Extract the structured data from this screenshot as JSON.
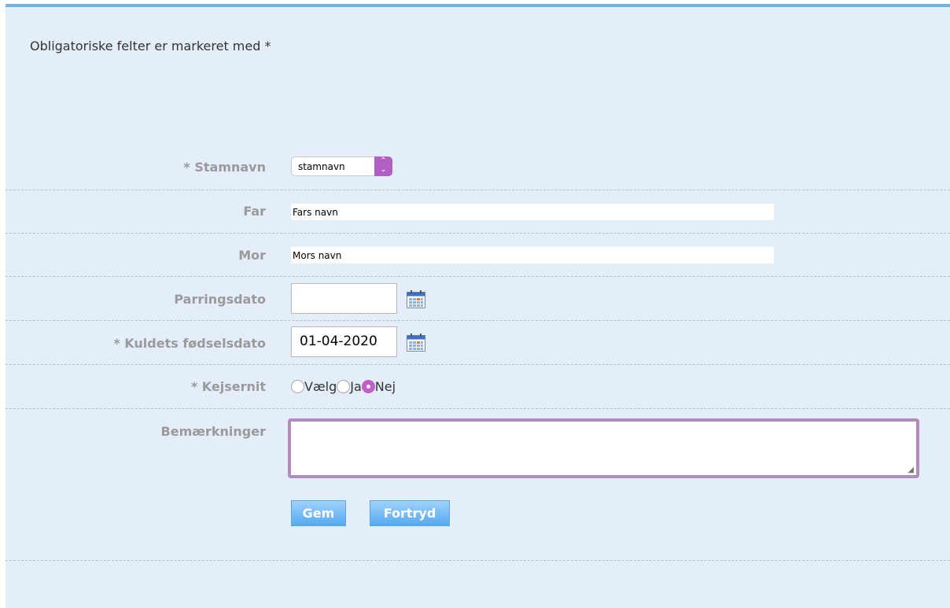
{
  "form": {
    "required_note": "Obligatoriske felter er markeret med *",
    "fields": {
      "stamnavn": {
        "label": "* Stamnavn",
        "value": "stamnavn"
      },
      "far": {
        "label": "Far",
        "value": "Fars navn"
      },
      "mor": {
        "label": "Mor",
        "value": "Mors navn"
      },
      "parringsdato": {
        "label": "Parringsdato",
        "value": ""
      },
      "fodselsdato": {
        "label": "* Kuldets fødselsdato",
        "value": "01-04-2020"
      },
      "kejsernit": {
        "label": "* Kejsernit",
        "options": [
          "Vælg",
          "Ja",
          "Nej"
        ],
        "selected": "Nej"
      },
      "bemaerkninger": {
        "label": "Bemærkninger",
        "value": ""
      }
    },
    "buttons": {
      "save": "Gem",
      "cancel": "Fortryd"
    }
  },
  "colors": {
    "panel_bg": "#e4eef9",
    "top_border": "#6db4ee",
    "label": "#9a9a9a",
    "accent_purple": "#b15fc3",
    "button_blue": "#55a9ef"
  },
  "icons": {
    "calendar": "calendar-icon",
    "select_arrows": "chevron-updown-icon"
  }
}
